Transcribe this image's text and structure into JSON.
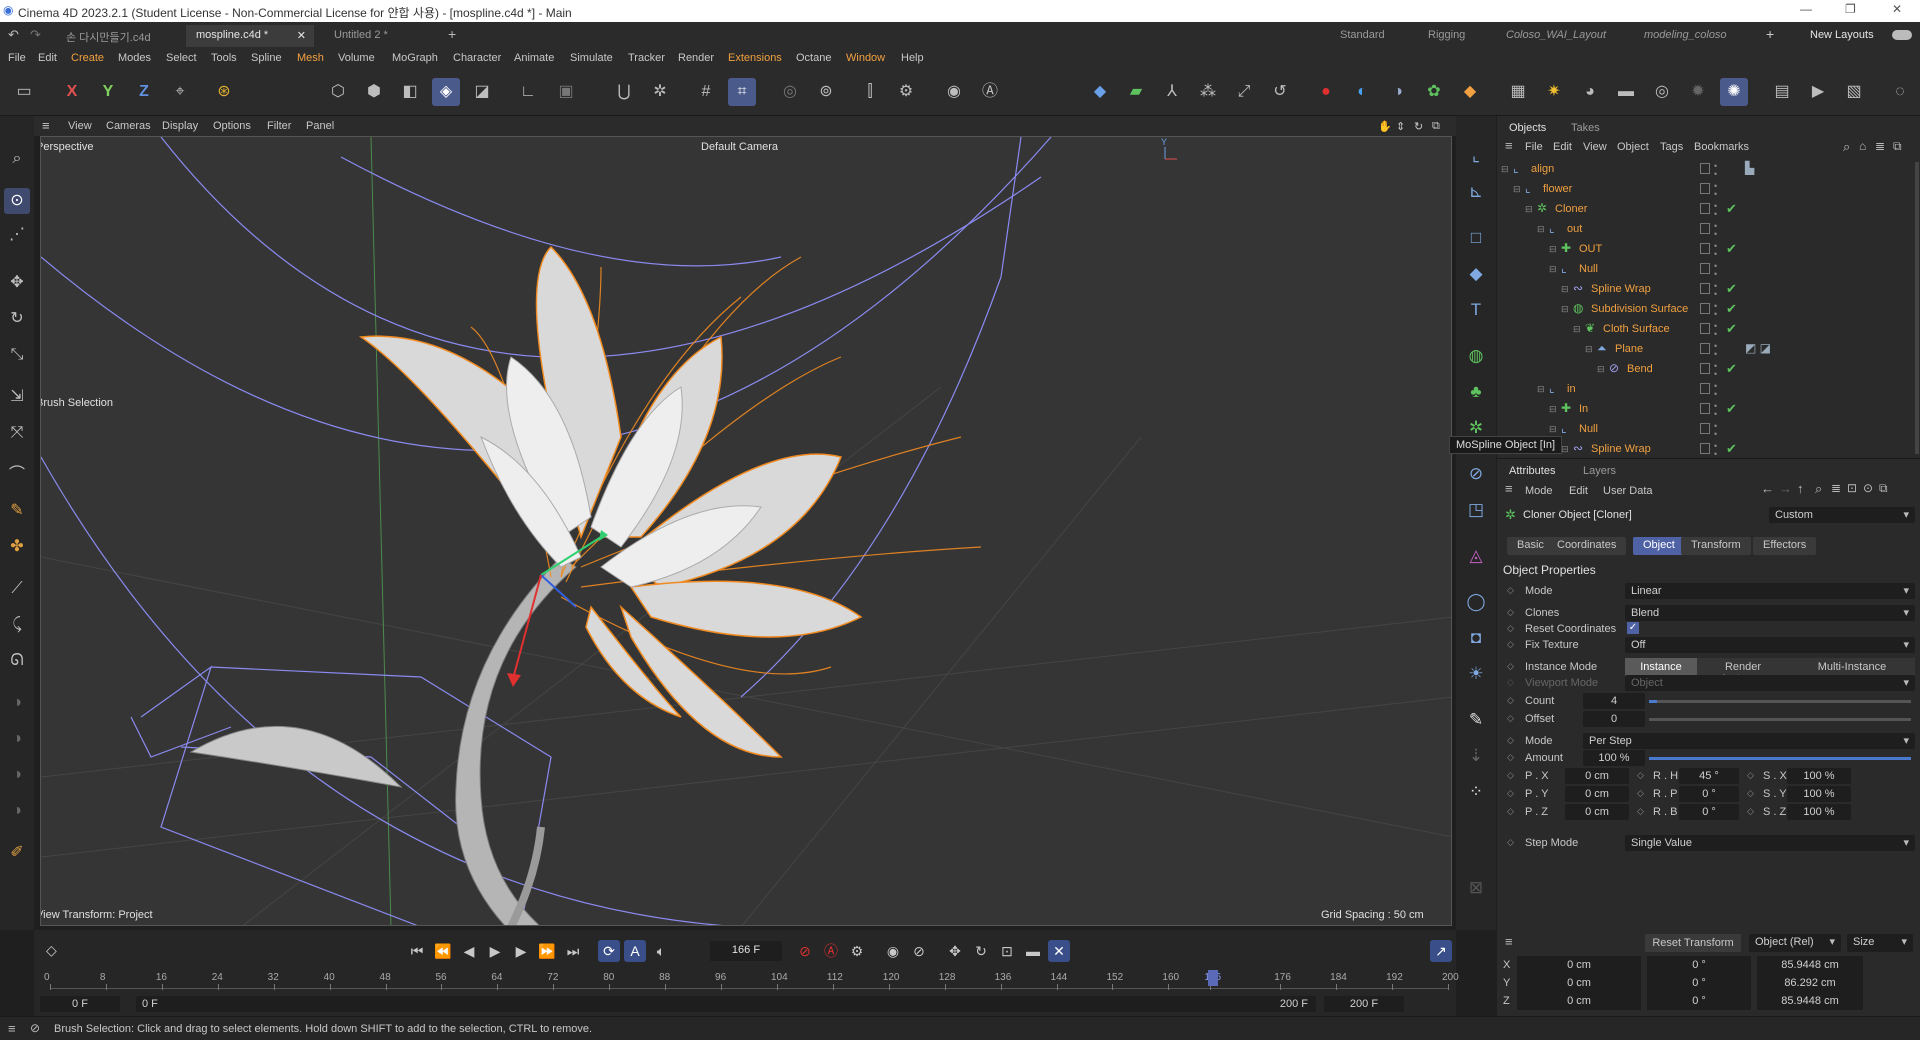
{
  "window": {
    "title": "Cinema 4D 2023.2.1 (Student License - Non-Commercial License for 얀합 사용) - [mospline.c4d *] - Main",
    "controls": [
      "—",
      "❐",
      "✕"
    ]
  },
  "doc_tabs": [
    {
      "label": "손 다시만들기.c4d",
      "active": false
    },
    {
      "label": "mospline.c4d *",
      "active": true
    },
    {
      "label": "Untitled 2 *",
      "active": false
    }
  ],
  "tab_close": "✕",
  "tab_add": "+",
  "layouts": [
    {
      "label": "Standard",
      "italic": false
    },
    {
      "label": "Rigging",
      "italic": false
    },
    {
      "label": "Coloso_WAI_Layout",
      "italic": true
    },
    {
      "label": "modeling_coloso",
      "italic": true
    }
  ],
  "layouts_add": "+",
  "new_layouts": "New Layouts",
  "menus": [
    "File",
    "Edit",
    "Create",
    "Modes",
    "Select",
    "Tools",
    "Spline",
    "Mesh",
    "Volume",
    "MoGraph",
    "Character",
    "Animate",
    "Simulate",
    "Tracker",
    "Render",
    "Extensions",
    "Octane",
    "Window",
    "Help"
  ],
  "highlight_menus": [
    "Create",
    "Mesh",
    "Extensions",
    "Window"
  ],
  "toolbar_axes": [
    "X",
    "Y",
    "Z"
  ],
  "viewport_menu": [
    "View",
    "Cameras",
    "Display",
    "Options",
    "Filter",
    "Panel"
  ],
  "viewport": {
    "name": "Perspective",
    "camera": "Default Camera",
    "brush_label": "Brush Selection",
    "view_transform": "View Transform: Project",
    "grid_spacing": "Grid Spacing : 50 cm"
  },
  "object_manager": {
    "tabs": [
      "Objects",
      "Takes"
    ],
    "menu": [
      "File",
      "Edit",
      "View",
      "Object",
      "Tags",
      "Bookmarks"
    ],
    "objects": [
      {
        "name": "align",
        "depth": 0,
        "icon": "null",
        "check": false,
        "tag": "▙"
      },
      {
        "name": "flower",
        "depth": 1,
        "icon": "null",
        "check": false
      },
      {
        "name": "Cloner",
        "depth": 2,
        "icon": "cloner",
        "check": true
      },
      {
        "name": "out",
        "depth": 3,
        "icon": "null",
        "check": false
      },
      {
        "name": "OUT",
        "depth": 4,
        "icon": "mospline",
        "check": true
      },
      {
        "name": "Null",
        "depth": 4,
        "icon": "null",
        "check": false
      },
      {
        "name": "Spline Wrap",
        "depth": 5,
        "icon": "wrap",
        "check": true
      },
      {
        "name": "Subdivision Surface",
        "depth": 5,
        "icon": "subdiv",
        "check": true
      },
      {
        "name": "Cloth Surface",
        "depth": 6,
        "icon": "cloth",
        "check": true
      },
      {
        "name": "Plane",
        "depth": 7,
        "icon": "plane",
        "check": false,
        "tag": "◩ ◪"
      },
      {
        "name": "Bend",
        "depth": 8,
        "icon": "bend",
        "check": true
      },
      {
        "name": "in",
        "depth": 3,
        "icon": "null",
        "check": false
      },
      {
        "name": "In",
        "depth": 4,
        "icon": "mospline",
        "check": true
      },
      {
        "name": "Null",
        "depth": 4,
        "icon": "null",
        "check": false
      },
      {
        "name": "Spline Wrap",
        "depth": 5,
        "icon": "wrap",
        "check": true
      }
    ],
    "tooltip": "MoSpline Object [In]"
  },
  "attributes": {
    "tabs": [
      "Attributes",
      "Layers"
    ],
    "menu": [
      "Mode",
      "Edit",
      "User Data"
    ],
    "object_title": "Cloner Object [Cloner]",
    "preset": "Custom",
    "sub_tabs": [
      "Basic",
      "Coordinates",
      "Object",
      "Transform",
      "Effectors"
    ],
    "active_sub_tab": "Object",
    "section": "Object Properties",
    "mode_label": "Mode",
    "mode_value": "Linear",
    "clones_label": "Clones",
    "clones_value": "Blend",
    "reset_label": "Reset Coordinates",
    "fix_label": "Fix Texture",
    "fix_value": "Off",
    "instance_label": "Instance Mode",
    "instance_options": [
      "Instance",
      "Render Instance",
      "Multi-Instance"
    ],
    "viewport_mode_label": "Viewport Mode",
    "viewport_mode_value": "Object",
    "count_label": "Count",
    "count_value": "4",
    "count_fill": 0.03,
    "offset_label": "Offset",
    "offset_value": "0",
    "offset_fill": 0.0,
    "step_label": "Mode",
    "step_value": "Per Step",
    "amount_label": "Amount",
    "amount_value": "100 %",
    "amount_fill": 1.0,
    "p_labels": [
      "P . X",
      "P . Y",
      "P . Z"
    ],
    "p_values": [
      "0 cm",
      "0 cm",
      "0 cm"
    ],
    "r_labels": [
      "R . H",
      "R . P",
      "R . B"
    ],
    "r_values": [
      "45 °",
      "0 °",
      "0 °"
    ],
    "s_labels": [
      "S . X",
      "S . Y",
      "S . Z"
    ],
    "s_values": [
      "100 %",
      "100 %",
      "100 %"
    ],
    "stepmode_label": "Step Mode",
    "stepmode_value": "Single Value"
  },
  "timeline": {
    "current_frame": "166 F",
    "ticks": [
      "0",
      "8",
      "16",
      "24",
      "32",
      "40",
      "48",
      "56",
      "64",
      "72",
      "80",
      "88",
      "96",
      "104",
      "112",
      "120",
      "128",
      "136",
      "144",
      "152",
      "160",
      "166",
      "176",
      "184",
      "192",
      "200"
    ],
    "start_field": "0 F",
    "start_field2": "0 F",
    "end_field": "200 F",
    "end_field2": "200 F"
  },
  "coords": {
    "reset_transform": "Reset Transform",
    "space": "Object (Rel)",
    "mode": "Size",
    "rows": [
      {
        "axis": "X",
        "pos": "0 cm",
        "rot": "0 °",
        "size": "85.9448 cm"
      },
      {
        "axis": "Y",
        "pos": "0 cm",
        "rot": "0 °",
        "size": "86.292 cm"
      },
      {
        "axis": "Z",
        "pos": "0 cm",
        "rot": "0 °",
        "size": "85.9448 cm"
      }
    ]
  },
  "status": "Brush Selection: Click and drag to select elements. Hold down SHIFT to add to the selection, CTRL to remove.",
  "colors": {
    "accent": "#4f62a6",
    "object_name": "#f0a040",
    "check": "#5ec35e",
    "record": "#e03030"
  }
}
